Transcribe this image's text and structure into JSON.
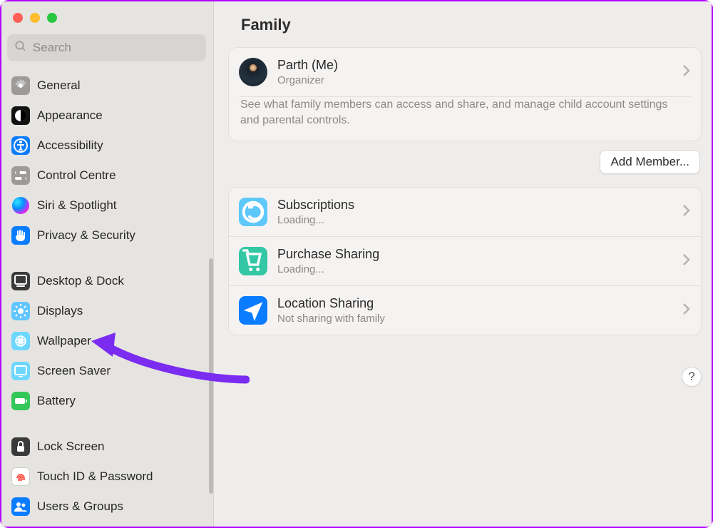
{
  "header": {
    "title": "Family"
  },
  "search": {
    "placeholder": "Search",
    "value": ""
  },
  "sidebar": {
    "items": [
      {
        "label": "General"
      },
      {
        "label": "Appearance"
      },
      {
        "label": "Accessibility"
      },
      {
        "label": "Control Centre"
      },
      {
        "label": "Siri & Spotlight"
      },
      {
        "label": "Privacy & Security"
      },
      {
        "label": "Desktop & Dock"
      },
      {
        "label": "Displays"
      },
      {
        "label": "Wallpaper"
      },
      {
        "label": "Screen Saver"
      },
      {
        "label": "Battery"
      },
      {
        "label": "Lock Screen"
      },
      {
        "label": "Touch ID & Password"
      },
      {
        "label": "Users & Groups"
      }
    ]
  },
  "family": {
    "member": {
      "name": "Parth (Me)",
      "role": "Organizer"
    },
    "description": "See what family members can access and share, and manage child account settings and parental controls.",
    "add_member_label": "Add Member..."
  },
  "shared": {
    "items": [
      {
        "title": "Subscriptions",
        "subtitle": "Loading..."
      },
      {
        "title": "Purchase Sharing",
        "subtitle": "Loading..."
      },
      {
        "title": "Location Sharing",
        "subtitle": "Not sharing with family"
      }
    ]
  },
  "help_label": "?",
  "colors": {
    "annotation": "#7a2cf0",
    "frame": "#b100ff"
  }
}
